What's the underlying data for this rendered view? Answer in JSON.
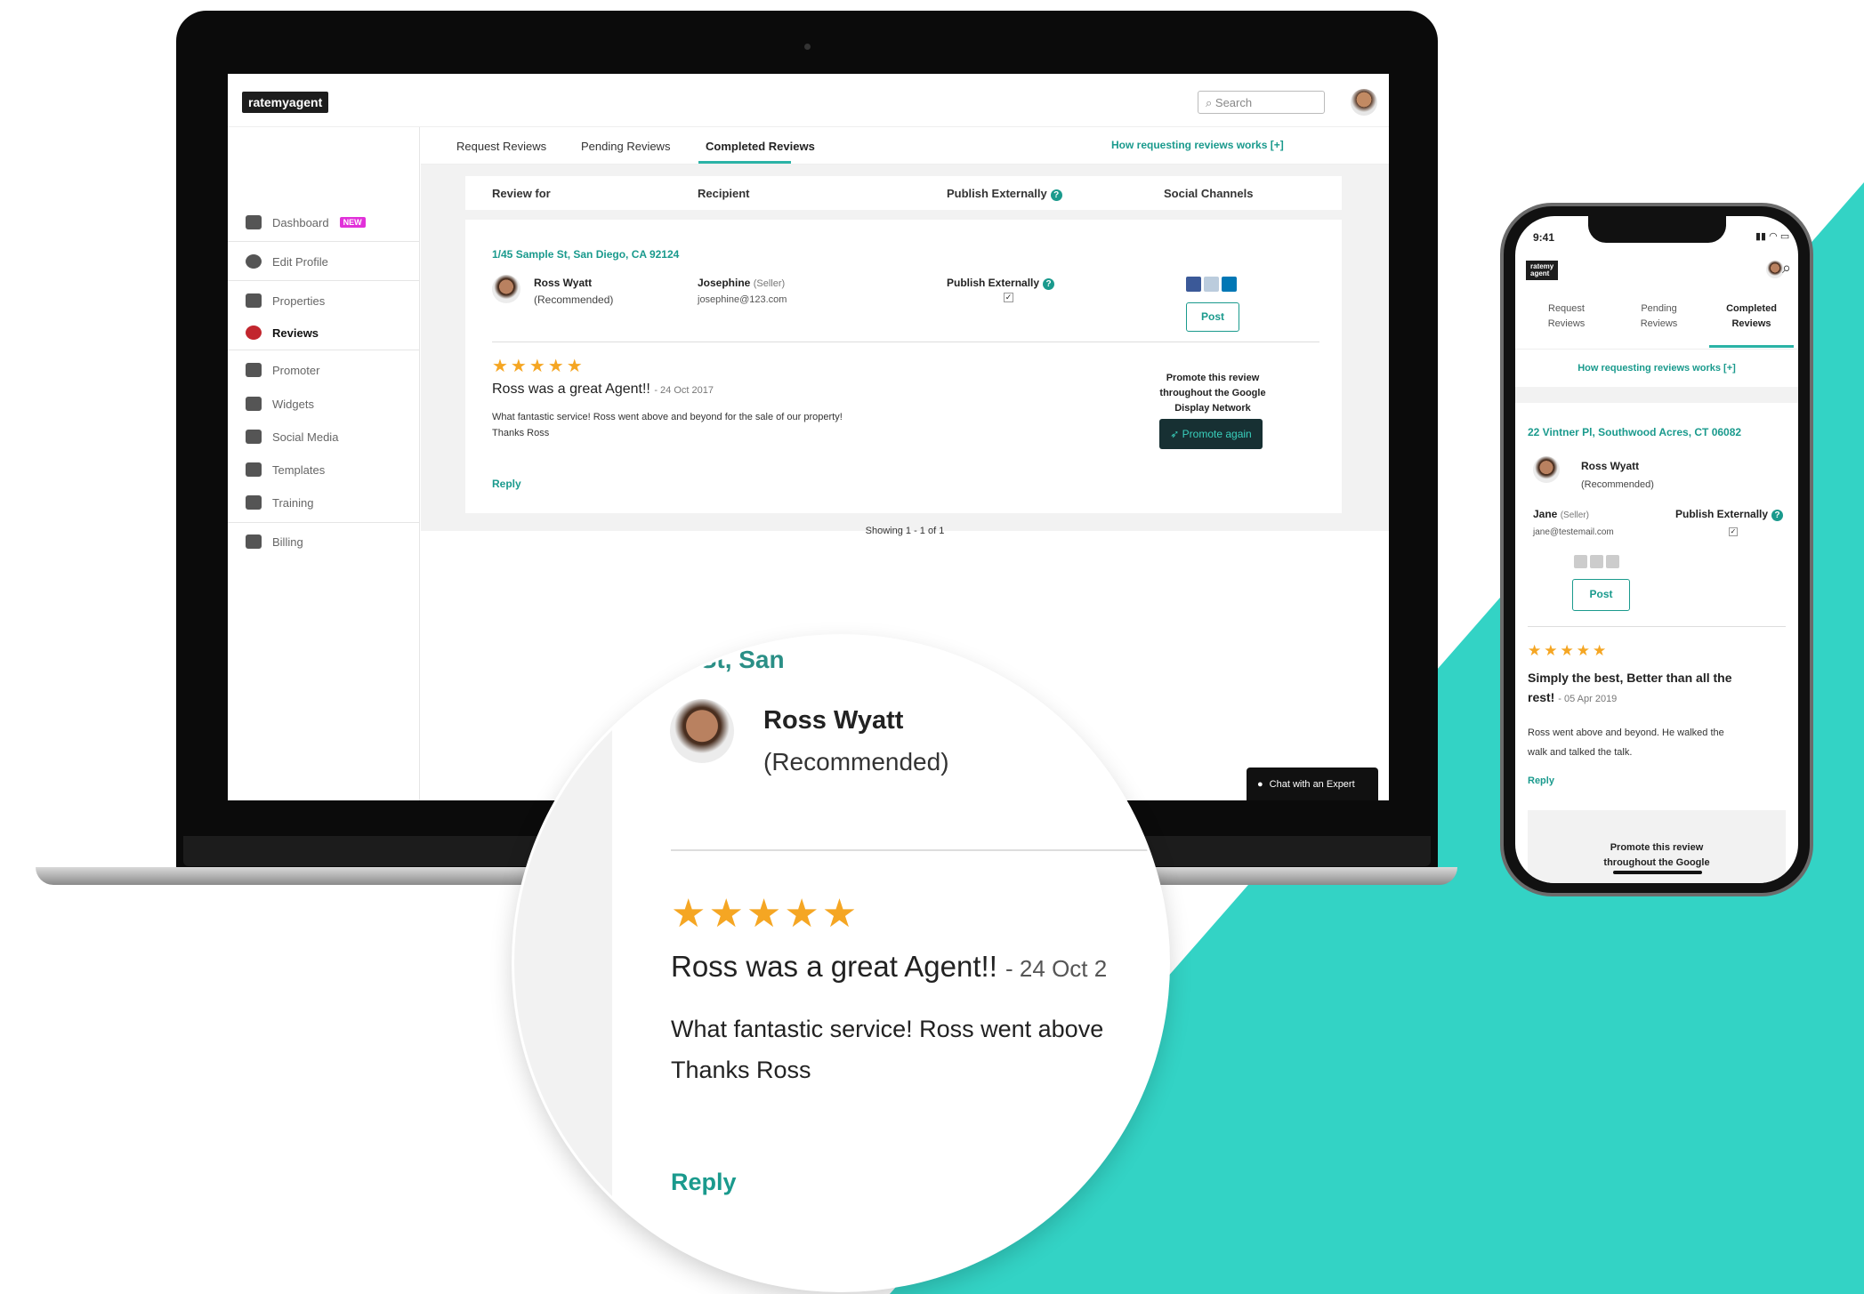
{
  "brand": {
    "logo_text": "ratemyagent",
    "teal": "#33d3c5",
    "accent": "#1a9a8d",
    "new_badge_color": "#e130d9"
  },
  "laptop": {
    "search": {
      "placeholder": "Search"
    },
    "sidebar": {
      "items": [
        {
          "label": "Dashboard",
          "icon": "dashboard-icon",
          "badge": "NEW"
        },
        {
          "label": "Edit Profile",
          "icon": "user-icon"
        },
        {
          "label": "Properties",
          "icon": "building-icon"
        },
        {
          "label": "Reviews",
          "icon": "reviews-icon",
          "active": true
        },
        {
          "label": "Promoter",
          "icon": "rocket-icon"
        },
        {
          "label": "Widgets",
          "icon": "puzzle-icon"
        },
        {
          "label": "Social Media",
          "icon": "social-icon"
        },
        {
          "label": "Templates",
          "icon": "templates-icon"
        },
        {
          "label": "Training",
          "icon": "monitor-icon"
        },
        {
          "label": "Billing",
          "icon": "billing-icon"
        }
      ]
    },
    "tabs": [
      "Request Reviews",
      "Pending Reviews",
      "Completed Reviews"
    ],
    "how_link": "How requesting reviews works [+]",
    "table_headers": {
      "review_for": "Review for",
      "recipient": "Recipient",
      "publish": "Publish Externally",
      "social": "Social Channels"
    },
    "review": {
      "address": "1/45 Sample St, San Diego, CA 92124",
      "agent_name": "Ross Wyatt",
      "agent_status": "(Recommended)",
      "recipient_name": "Josephine",
      "recipient_role": "(Seller)",
      "recipient_email": "josephine@123.com",
      "publish_label": "Publish Externally",
      "post_label": "Post",
      "stars": "★★★★★",
      "title": "Ross was a great Agent!!",
      "date": "- 24 Oct 2017",
      "body_line1": "What fantastic service! Ross went above and beyond for the sale of our property!",
      "body_line2": "Thanks Ross",
      "reply": "Reply",
      "promote_text_line1": "Promote this review",
      "promote_text_line2": "throughout the Google",
      "promote_text_line3": "Display Network",
      "promote_btn": "Promote again"
    },
    "pagination": "Showing 1 - 1 of 1",
    "chat_btn": "Chat with an Expert"
  },
  "phone": {
    "time": "9:41",
    "logo_line1": "ratemy",
    "logo_line2": "agent",
    "tabs": [
      {
        "line1": "Request",
        "line2": "Reviews"
      },
      {
        "line1": "Pending",
        "line2": "Reviews"
      },
      {
        "line1": "Completed",
        "line2": "Reviews"
      }
    ],
    "how_link": "How requesting reviews works [+]",
    "address": "22 Vintner Pl, Southwood Acres, CT 06082",
    "agent_name": "Ross Wyatt",
    "agent_status": "(Recommended)",
    "recipient_name": "Jane",
    "recipient_role": "(Seller)",
    "recipient_email": "jane@testemail.com",
    "publish_label": "Publish Externally",
    "post_label": "Post",
    "stars": "★★★★★",
    "title_line1": "Simply the best, Better than all the",
    "title_line2": "rest!",
    "date": "- 05 Apr 2019",
    "body_line1": "Ross went above and beyond. He walked the",
    "body_line2": "walk and talked the talk.",
    "reply": "Reply",
    "promote_line1": "Promote this review",
    "promote_line2": "throughout the Google"
  },
  "magnifier": {
    "address_fragment": "..mple St, San",
    "agent_name": "Ross Wyatt",
    "agent_status": "(Recommended)",
    "stars": "★★★★★",
    "title": "Ross was a great Agent!!",
    "date": "- 24 Oct 2",
    "body_line1": "What fantastic service! Ross went above",
    "body_line2": "Thanks Ross",
    "reply": "Reply"
  }
}
